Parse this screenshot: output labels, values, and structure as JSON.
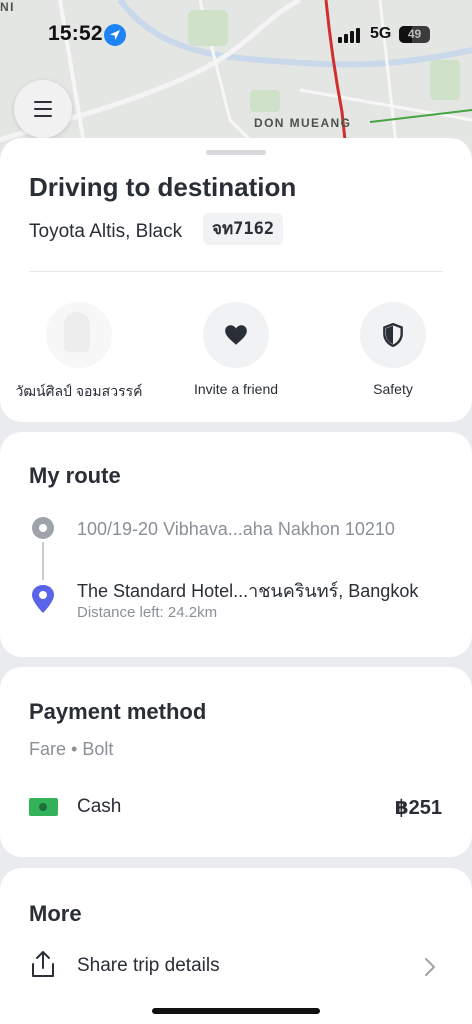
{
  "status_bar": {
    "time": "15:52",
    "network": "5G",
    "battery": "49"
  },
  "map": {
    "area_label": "DON MUEANG",
    "edge_label": "NI"
  },
  "trip": {
    "title": "Driving to destination",
    "vehicle": "Toyota Altis, Black",
    "plate": "จท7162"
  },
  "actions": [
    {
      "label": "วัฒน์ศิลป์ จอมสวรรค์",
      "icon": "driver-photo"
    },
    {
      "label": "Invite a friend",
      "icon": "heart-icon"
    },
    {
      "label": "Safety",
      "icon": "shield-icon"
    }
  ],
  "route": {
    "title": "My route",
    "pickup": "100/19-20 Vibhava...aha Nakhon 10210",
    "destination": "The Standard Hotel...าชนครินทร์, Bangkok",
    "distance_left": "Distance left: 24.2km"
  },
  "payment": {
    "title": "Payment method",
    "fare": "Fare • Bolt",
    "method": "Cash",
    "amount": "฿251"
  },
  "more": {
    "title": "More",
    "share": "Share trip details"
  },
  "colors": {
    "accent_pin": "#5b63e8",
    "cash_green": "#34b25a",
    "route_red": "#d0302c",
    "location_blue": "#1e84f5"
  }
}
